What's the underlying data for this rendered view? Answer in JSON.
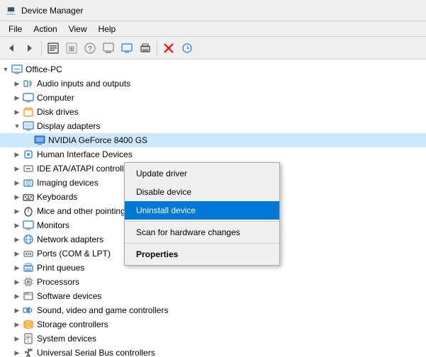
{
  "titleBar": {
    "title": "Device Manager",
    "icon": "💻"
  },
  "menuBar": {
    "items": [
      "File",
      "Action",
      "View",
      "Help"
    ]
  },
  "toolbar": {
    "buttons": [
      "◀",
      "▶",
      "⊞",
      "⊟",
      "❓",
      "⊟",
      "🖥",
      "🖨",
      "✖",
      "⬇"
    ]
  },
  "tree": {
    "items": [
      {
        "id": "office-pc",
        "label": "Office-PC",
        "indent": 0,
        "expanded": true,
        "icon": "🖥",
        "type": "root"
      },
      {
        "id": "audio",
        "label": "Audio inputs and outputs",
        "indent": 1,
        "expanded": false,
        "icon": "🔊",
        "type": "category"
      },
      {
        "id": "computer",
        "label": "Computer",
        "indent": 1,
        "expanded": false,
        "icon": "💻",
        "type": "category"
      },
      {
        "id": "disk",
        "label": "Disk drives",
        "indent": 1,
        "expanded": false,
        "icon": "💾",
        "type": "category"
      },
      {
        "id": "display",
        "label": "Display adapters",
        "indent": 1,
        "expanded": true,
        "icon": "🖥",
        "type": "category"
      },
      {
        "id": "nvidia",
        "label": "NVIDIA GeForce 8400 GS",
        "indent": 2,
        "expanded": false,
        "icon": "🖥",
        "type": "device",
        "selected": true,
        "contextSelected": true
      },
      {
        "id": "hid",
        "label": "Human Interface Devices",
        "indent": 1,
        "expanded": false,
        "icon": "🎮",
        "type": "category"
      },
      {
        "id": "ide",
        "label": "IDE ATA/ATAPI controllers",
        "indent": 1,
        "expanded": false,
        "icon": "💿",
        "type": "category"
      },
      {
        "id": "imaging",
        "label": "Imaging devices",
        "indent": 1,
        "expanded": false,
        "icon": "📷",
        "type": "category"
      },
      {
        "id": "keyboards",
        "label": "Keyboards",
        "indent": 1,
        "expanded": false,
        "icon": "⌨",
        "type": "category"
      },
      {
        "id": "mice",
        "label": "Mice and other pointing devic...",
        "indent": 1,
        "expanded": false,
        "icon": "🖱",
        "type": "category"
      },
      {
        "id": "monitors",
        "label": "Monitors",
        "indent": 1,
        "expanded": false,
        "icon": "🖥",
        "type": "category"
      },
      {
        "id": "network",
        "label": "Network adapters",
        "indent": 1,
        "expanded": false,
        "icon": "🌐",
        "type": "category"
      },
      {
        "id": "ports",
        "label": "Ports (COM & LPT)",
        "indent": 1,
        "expanded": false,
        "icon": "🔌",
        "type": "category"
      },
      {
        "id": "print",
        "label": "Print queues",
        "indent": 1,
        "expanded": false,
        "icon": "🖨",
        "type": "category"
      },
      {
        "id": "processors",
        "label": "Processors",
        "indent": 1,
        "expanded": false,
        "icon": "⚙",
        "type": "category"
      },
      {
        "id": "software",
        "label": "Software devices",
        "indent": 1,
        "expanded": false,
        "icon": "💾",
        "type": "category"
      },
      {
        "id": "sound",
        "label": "Sound, video and game controllers",
        "indent": 1,
        "expanded": false,
        "icon": "🎵",
        "type": "category"
      },
      {
        "id": "storage",
        "label": "Storage controllers",
        "indent": 1,
        "expanded": false,
        "icon": "💾",
        "type": "category"
      },
      {
        "id": "system",
        "label": "System devices",
        "indent": 1,
        "expanded": false,
        "icon": "⚙",
        "type": "category"
      },
      {
        "id": "usb",
        "label": "Universal Serial Bus controllers",
        "indent": 1,
        "expanded": false,
        "icon": "🔌",
        "type": "category"
      }
    ]
  },
  "contextMenu": {
    "items": [
      {
        "id": "update-driver",
        "label": "Update driver",
        "bold": false,
        "active": false
      },
      {
        "id": "disable-device",
        "label": "Disable device",
        "bold": false,
        "active": false
      },
      {
        "id": "uninstall-device",
        "label": "Uninstall device",
        "bold": false,
        "active": true
      },
      {
        "id": "sep1",
        "type": "sep"
      },
      {
        "id": "scan",
        "label": "Scan for hardware changes",
        "bold": false,
        "active": false
      },
      {
        "id": "sep2",
        "type": "sep"
      },
      {
        "id": "properties",
        "label": "Properties",
        "bold": true,
        "active": false
      }
    ]
  }
}
